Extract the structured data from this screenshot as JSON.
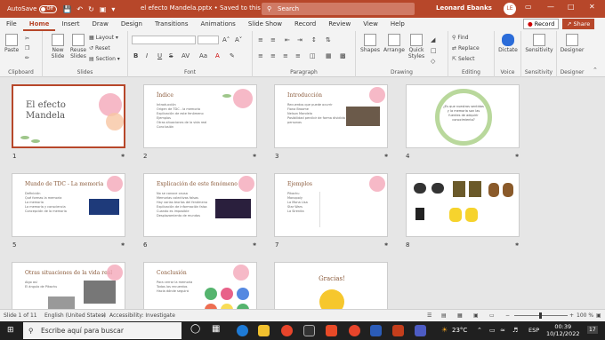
{
  "titlebar": {
    "autosave_label": "AutoSave",
    "autosave_state": "Off",
    "doc_title": "el efecto Mandela.pptx • Saved to this PC",
    "search_placeholder": "Search",
    "user_name": "Leonard Ebanks",
    "user_initials": "LE"
  },
  "tabs": [
    "File",
    "Home",
    "Insert",
    "Draw",
    "Design",
    "Transitions",
    "Animations",
    "Slide Show",
    "Record",
    "Review",
    "View",
    "Help"
  ],
  "record_label": "Record",
  "share_label": "Share",
  "ribbon": {
    "clipboard": {
      "paste": "Paste",
      "group": "Clipboard"
    },
    "slides": {
      "new_slide": "New Slide",
      "reuse": "Reuse Slides",
      "layout": "Layout",
      "reset": "Reset",
      "section": "Section",
      "group": "Slides"
    },
    "font": {
      "group": "Font",
      "bold": "B",
      "italic": "I",
      "underline": "U",
      "strike": "S"
    },
    "paragraph": {
      "group": "Paragraph"
    },
    "drawing": {
      "shapes": "Shapes",
      "arrange": "Arrange",
      "quick_styles": "Quick Styles",
      "group": "Drawing"
    },
    "editing": {
      "find": "Find",
      "replace": "Replace",
      "select": "Select",
      "group": "Editing"
    },
    "voice": {
      "dictate": "Dictate",
      "group": "Voice"
    },
    "sensitivity": {
      "label": "Sensitivity",
      "group": "Sensitivity"
    },
    "designer": {
      "label": "Designer",
      "group": "Designer"
    }
  },
  "slides": [
    {
      "num": "1",
      "title": "El efecto Mandela",
      "body": ""
    },
    {
      "num": "2",
      "title": "Índice",
      "body": "Introducción\nOrigen de TDC - la memoria\nExplicación de este fenómeno\nEjemplos\nOtras situaciones de la vida real\nConclusión"
    },
    {
      "num": "3",
      "title": "Introducción",
      "body": "Recuerdos que puede ocurrir\nFiona Broome\nNelson Mandela\nPosibilidad percibir de forma dividida a personas"
    },
    {
      "num": "4",
      "title": "¿Es que nuestros sentidos y la memoria son las fuentes de adquirir conocimiento?",
      "body": ""
    },
    {
      "num": "5",
      "title": "Mundo de TDC - La memoria",
      "body": "Definición\nQué formas la memoria\nLa memoria\nLa memoria y consciencia\nConcepción de la memoria"
    },
    {
      "num": "6",
      "title": "Explicación de este fenómeno",
      "body": "No se conoce causa\nMemorias colectivas falsas\nHay varias teorías del fenómeno\nExplicación de información falsa\nCuando es imposible\nDesplazamiento de mundos"
    },
    {
      "num": "7",
      "title": "Ejemplos",
      "body": "Pikachu\nMonopoly\nLa Mona Lisa\nStar Wars\nLa Sirenita"
    },
    {
      "num": "8",
      "title": "",
      "body": ""
    },
    {
      "num": "9",
      "title": "Otras situaciones de la vida real",
      "body": "Algo así\nEl ángulo de Pikachu"
    },
    {
      "num": "10",
      "title": "Conclusión",
      "body": "Para cerrar la memoria\nTodos los recuerdos\nHacia dónde seguirá"
    },
    {
      "num": "11",
      "title": "Gracias!",
      "body": ""
    }
  ],
  "statusbar": {
    "slide_info": "Slide 1 of 11",
    "language": "English (United States)",
    "accessibility": "Accessibility: Investigate",
    "zoom": "100 %"
  },
  "taskbar": {
    "search_placeholder": "Escribe aquí para buscar",
    "temp": "23°C",
    "lang": "ESP",
    "time": "00:39",
    "date": "10/12/2022",
    "notif": "17"
  },
  "colors": {
    "accent": "#b7472a",
    "taskbar": "#202020"
  }
}
